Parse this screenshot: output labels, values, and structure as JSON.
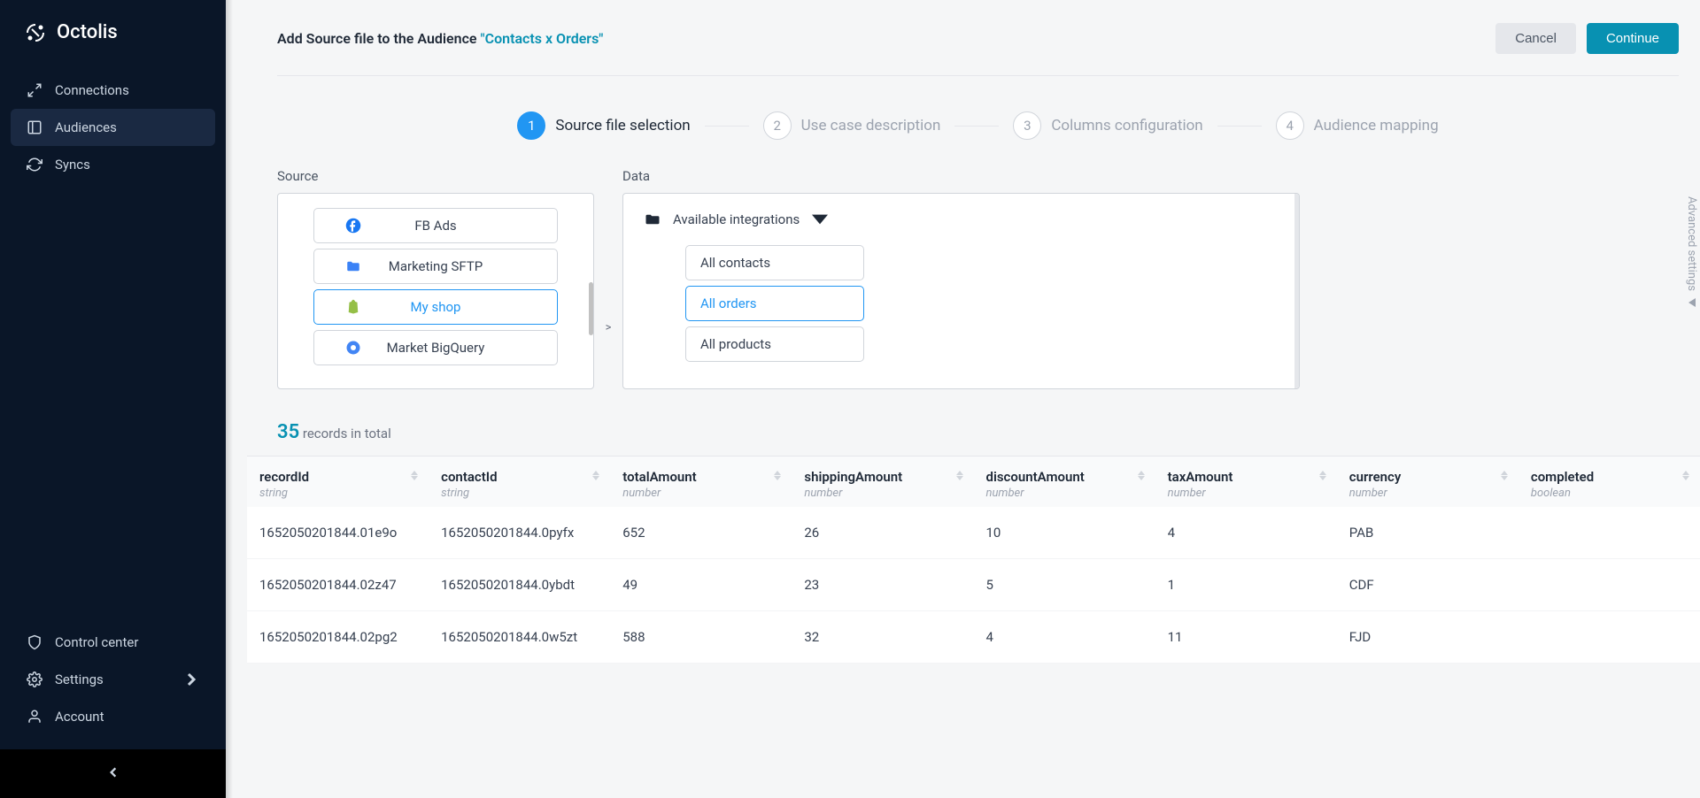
{
  "brand": "Octolis",
  "sidebar": {
    "nav": [
      {
        "label": "Connections"
      },
      {
        "label": "Audiences"
      },
      {
        "label": "Syncs"
      }
    ],
    "bottom": [
      {
        "label": "Control center"
      },
      {
        "label": "Settings"
      },
      {
        "label": "Account"
      }
    ]
  },
  "header": {
    "prefix": "Add Source file to the Audience ",
    "audience": "\"Contacts x Orders\"",
    "cancel": "Cancel",
    "continue": "Continue"
  },
  "steps": [
    {
      "num": "1",
      "label": "Source file selection"
    },
    {
      "num": "2",
      "label": "Use case description"
    },
    {
      "num": "3",
      "label": "Columns configuration"
    },
    {
      "num": "4",
      "label": "Audience mapping"
    }
  ],
  "panels": {
    "source_label": "Source",
    "data_label": "Data",
    "sources": [
      {
        "label": "FB Ads",
        "icon": "fb"
      },
      {
        "label": "Marketing SFTP",
        "icon": "folder"
      },
      {
        "label": "My shop",
        "icon": "shopify"
      },
      {
        "label": "Market BigQuery",
        "icon": "bq"
      }
    ],
    "data_title": "Available integrations",
    "data_items": [
      {
        "label": "All contacts"
      },
      {
        "label": "All orders"
      },
      {
        "label": "All products"
      }
    ],
    "arrow": ">"
  },
  "advanced": "Advanced settings",
  "records": {
    "count": "35",
    "suffix": "records in total"
  },
  "table": {
    "cols": [
      {
        "name": "recordId",
        "type": "string"
      },
      {
        "name": "contactId",
        "type": "string"
      },
      {
        "name": "totalAmount",
        "type": "number"
      },
      {
        "name": "shippingAmount",
        "type": "number"
      },
      {
        "name": "discountAmount",
        "type": "number"
      },
      {
        "name": "taxAmount",
        "type": "number"
      },
      {
        "name": "currency",
        "type": "number"
      },
      {
        "name": "completed",
        "type": "boolean"
      }
    ],
    "rows": [
      [
        "1652050201844.01e9o",
        "1652050201844.0pyfx",
        "652",
        "26",
        "10",
        "4",
        "PAB",
        ""
      ],
      [
        "1652050201844.02z47",
        "1652050201844.0ybdt",
        "49",
        "23",
        "5",
        "1",
        "CDF",
        ""
      ],
      [
        "1652050201844.02pg2",
        "1652050201844.0w5zt",
        "588",
        "32",
        "4",
        "11",
        "FJD",
        ""
      ]
    ]
  }
}
